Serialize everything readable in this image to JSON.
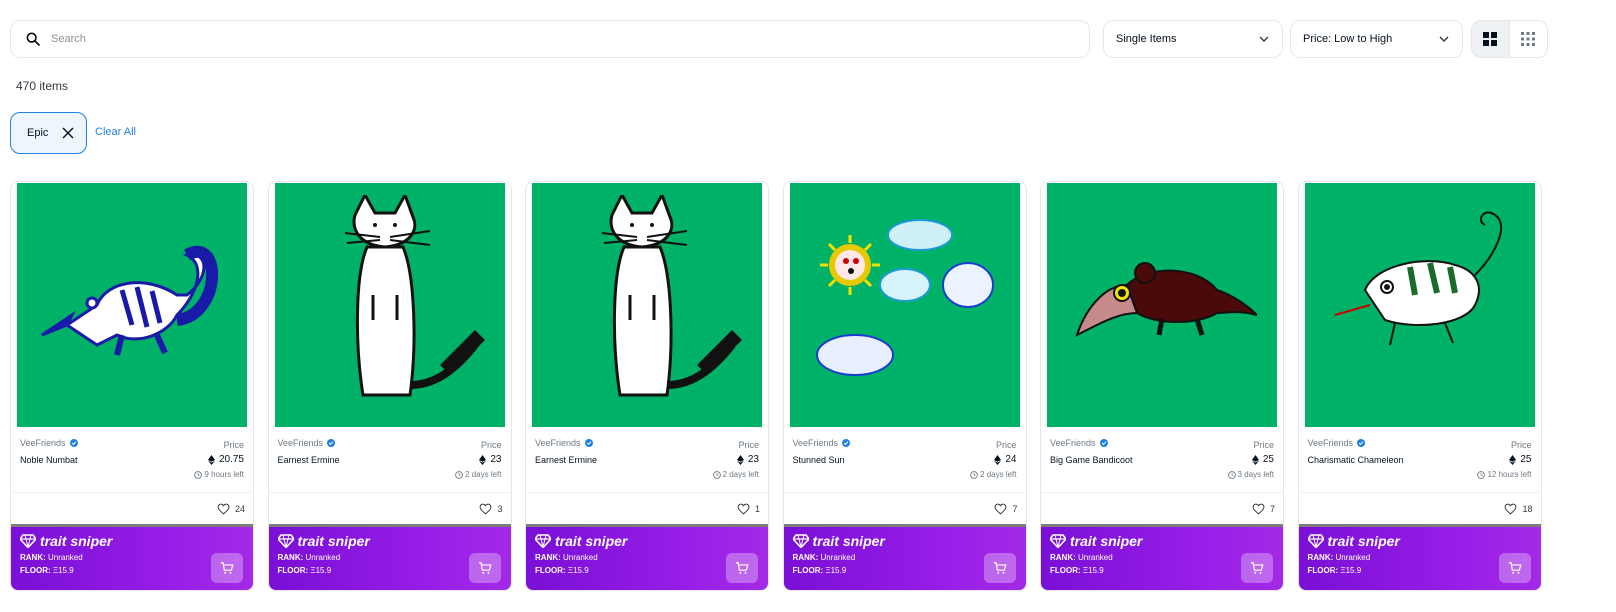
{
  "search": {
    "placeholder": "Search"
  },
  "filters": {
    "type_selected": "Single Items",
    "sort_selected": "Price: Low to High"
  },
  "item_count": "470 items",
  "active_filter": {
    "label": "Epic"
  },
  "clear_all": "Clear All",
  "cards": [
    {
      "collection": "VeeFriends",
      "name": "Noble Numbat",
      "price_label": "Price",
      "price": "20.75",
      "time_left": "9 hours left",
      "likes": "24",
      "sniper": {
        "brand": "trait sniper",
        "rank_label": "RANK:",
        "rank": "Unranked",
        "floor_label": "FLOOR:",
        "floor": "Ξ15.9"
      },
      "art": "numbat"
    },
    {
      "collection": "VeeFriends",
      "name": "Earnest Ermine",
      "price_label": "Price",
      "price": "23",
      "time_left": "2 days left",
      "likes": "3",
      "sniper": {
        "brand": "trait sniper",
        "rank_label": "RANK:",
        "rank": "Unranked",
        "floor_label": "FLOOR:",
        "floor": "Ξ15.9"
      },
      "art": "ermine"
    },
    {
      "collection": "VeeFriends",
      "name": "Earnest Ermine",
      "price_label": "Price",
      "price": "23",
      "time_left": "2 days left",
      "likes": "1",
      "sniper": {
        "brand": "trait sniper",
        "rank_label": "RANK:",
        "rank": "Unranked",
        "floor_label": "FLOOR:",
        "floor": "Ξ15.9"
      },
      "art": "ermine"
    },
    {
      "collection": "VeeFriends",
      "name": "Stunned Sun",
      "price_label": "Price",
      "price": "24",
      "time_left": "2 days left",
      "likes": "7",
      "sniper": {
        "brand": "trait sniper",
        "rank_label": "RANK:",
        "rank": "Unranked",
        "floor_label": "FLOOR:",
        "floor": "Ξ15.9"
      },
      "art": "sun"
    },
    {
      "collection": "VeeFriends",
      "name": "Big Game Bandicoot",
      "price_label": "Price",
      "price": "25",
      "time_left": "3 days left",
      "likes": "7",
      "sniper": {
        "brand": "trait sniper",
        "rank_label": "RANK:",
        "rank": "Unranked",
        "floor_label": "FLOOR:",
        "floor": "Ξ15.9"
      },
      "art": "bandicoot"
    },
    {
      "collection": "VeeFriends",
      "name": "Charismatic Chameleon",
      "price_label": "Price",
      "price": "25",
      "time_left": "12 hours left",
      "likes": "18",
      "sniper": {
        "brand": "trait sniper",
        "rank_label": "RANK:",
        "rank": "Unranked",
        "floor_label": "FLOOR:",
        "floor": "Ξ15.9"
      },
      "art": "chameleon"
    }
  ],
  "colors": {
    "accent": "#2081e2",
    "art_bg": "#00b168",
    "sniper_purple": "#8a16e0"
  }
}
